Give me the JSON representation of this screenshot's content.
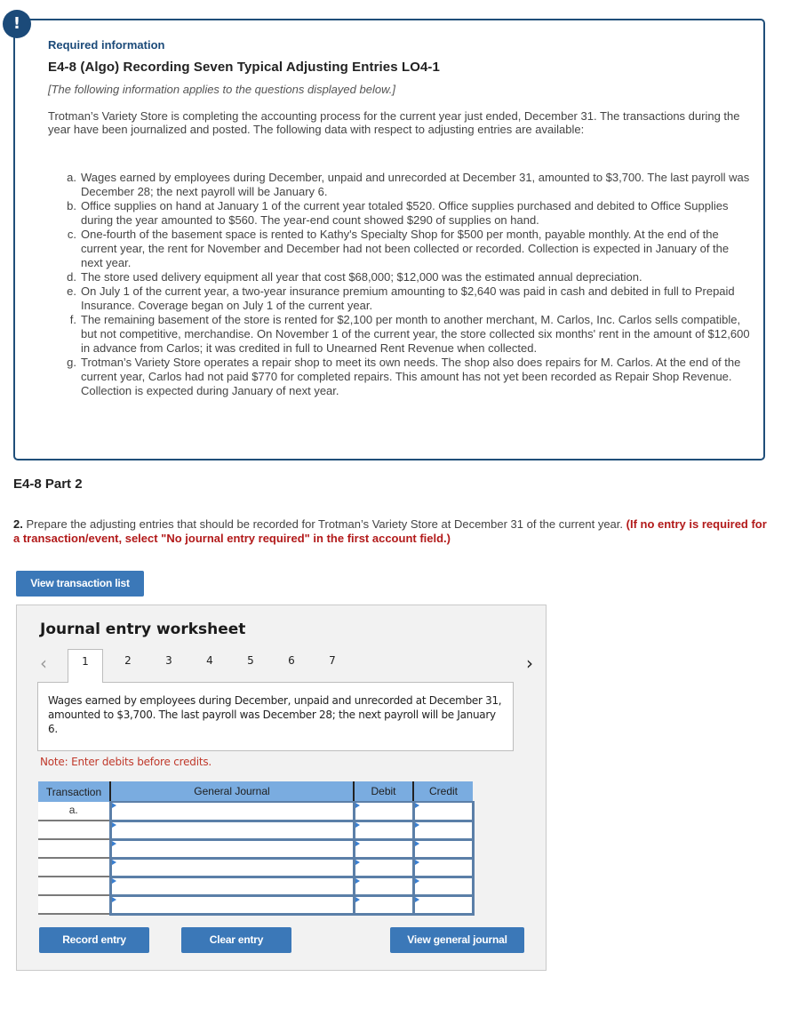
{
  "info_panel": {
    "alert_icon": "exclamation-icon",
    "alert_glyph": "!",
    "required_label": "Required information",
    "title": "E4-8 (Algo) Recording Seven Typical Adjusting Entries LO4-1",
    "applies_note": "[The following information applies to the questions displayed below.]",
    "intro": "Trotman’s Variety Store is completing the accounting process for the current year just ended, December 31. The transactions during the year have been journalized and posted. The following data with respect to adjusting entries are available:",
    "items": [
      {
        "marker": "a.",
        "text": "Wages earned by employees during December, unpaid and unrecorded at December 31, amounted to $3,700. The last payroll was December 28; the next payroll will be January 6."
      },
      {
        "marker": "b.",
        "text": "Office supplies on hand at January 1 of the current year totaled $520. Office supplies purchased and debited to Office Supplies during the year amounted to $560. The year-end count showed $290 of supplies on hand."
      },
      {
        "marker": "c.",
        "text": "One-fourth of the basement space is rented to Kathy's Specialty Shop for $500 per month, payable monthly. At the end of the current year, the rent for November and December had not been collected or recorded. Collection is expected in January of the next year."
      },
      {
        "marker": "d.",
        "text": "The store used delivery equipment all year that cost $68,000; $12,000 was the estimated annual depreciation."
      },
      {
        "marker": "e.",
        "text": "On July 1 of the current year, a two-year insurance premium amounting to $2,640 was paid in cash and debited in full to Prepaid Insurance. Coverage began on July 1 of the current year."
      },
      {
        "marker": "f.",
        "text": "The remaining basement of the store is rented for $2,100 per month to another merchant, M. Carlos, Inc. Carlos sells compatible, but not competitive, merchandise. On November 1 of the current year, the store collected six months' rent in the amount of $12,600 in advance from Carlos; it was credited in full to Unearned Rent Revenue when collected."
      },
      {
        "marker": "g.",
        "text": "Trotman’s Variety Store operates a repair shop to meet its own needs. The shop also does repairs for M. Carlos. At the end of the current year, Carlos had not paid $770 for completed repairs. This amount has not yet been recorded as Repair Shop Revenue. Collection is expected during January of next year."
      }
    ]
  },
  "part": {
    "title": "E4-8 Part 2",
    "question_number": "2.",
    "question_text": " Prepare the adjusting entries that should be recorded for Trotman’s Variety Store at December 31 of the current year. ",
    "warning": "(If no entry is required for a transaction/event, select \"No journal entry required\" in the first account field.)",
    "view_transaction_list_label": "View transaction list"
  },
  "worksheet": {
    "title": "Journal entry worksheet",
    "prev_icon": "chevron-left-icon",
    "next_icon": "chevron-right-icon",
    "prev_glyph": "‹",
    "next_glyph": "›",
    "active_tab": "1",
    "tabs": [
      "1",
      "2",
      "3",
      "4",
      "5",
      "6",
      "7"
    ],
    "description": "Wages earned by employees during December, unpaid and unrecorded at December 31, amounted to $3,700. The last payroll was December 28; the next payroll will be January 6.",
    "note": "Note: Enter debits before credits.",
    "table": {
      "headers": {
        "transaction": "Transaction",
        "general_journal": "General Journal",
        "debit": "Debit",
        "credit": "Credit"
      },
      "rows": [
        {
          "transaction": "a.",
          "account": "",
          "debit": "",
          "credit": ""
        },
        {
          "transaction": "",
          "account": "",
          "debit": "",
          "credit": ""
        },
        {
          "transaction": "",
          "account": "",
          "debit": "",
          "credit": ""
        },
        {
          "transaction": "",
          "account": "",
          "debit": "",
          "credit": ""
        },
        {
          "transaction": "",
          "account": "",
          "debit": "",
          "credit": ""
        },
        {
          "transaction": "",
          "account": "",
          "debit": "",
          "credit": ""
        }
      ]
    },
    "buttons": {
      "record": "Record entry",
      "clear": "Clear entry",
      "view_journal": "View general journal"
    }
  },
  "colors": {
    "panel_border": "#1f4e79",
    "accent_blue": "#3b78b8",
    "table_header": "#7aace0",
    "warning_red": "#b21a1a"
  }
}
